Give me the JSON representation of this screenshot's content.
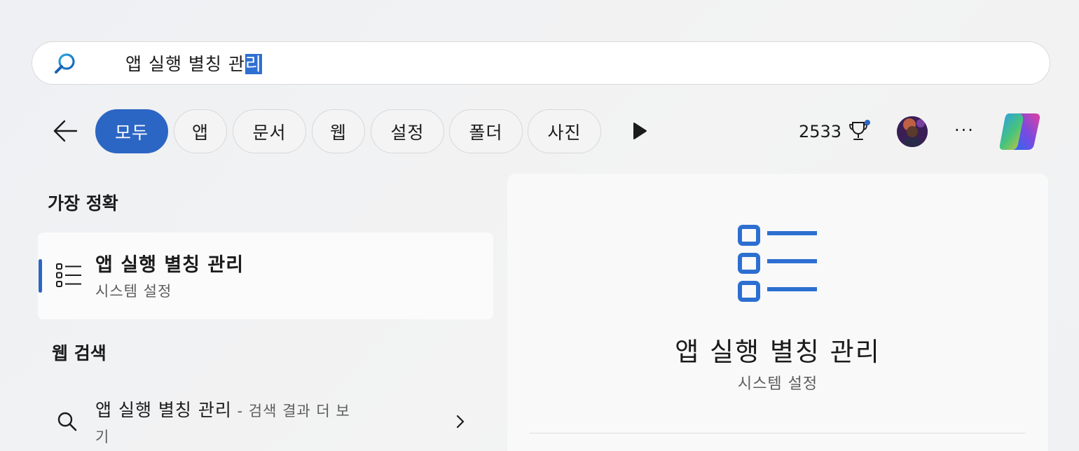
{
  "search": {
    "query_prefix": "앱 실행 별칭 관",
    "query_selected": "리"
  },
  "filters": {
    "tabs": [
      {
        "label": "모두",
        "active": true
      },
      {
        "label": "앱"
      },
      {
        "label": "문서"
      },
      {
        "label": "웹"
      },
      {
        "label": "설정"
      },
      {
        "label": "폴더"
      },
      {
        "label": "사진"
      }
    ]
  },
  "header": {
    "points": "2533",
    "accent_color": "#2c66c4"
  },
  "best_match": {
    "heading": "가장 정확",
    "title": "앱 실행 별칭 관리",
    "subtitle": "시스템 설정"
  },
  "web_search": {
    "heading": "웹 검색",
    "query": "앱 실행 별칭 관리",
    "suffix_line1": " - 검색 결과 더 보",
    "suffix_line2": "기"
  },
  "detail": {
    "title": "앱 실행 별칭 관리",
    "subtitle": "시스템 설정"
  },
  "icons": {
    "search": "search-icon",
    "back": "arrow-left-icon",
    "play": "play-icon",
    "trophy": "trophy-icon",
    "more": "more-icon",
    "copilot": "copilot-icon",
    "list": "list-settings-icon",
    "chevron": "chevron-right-icon"
  }
}
